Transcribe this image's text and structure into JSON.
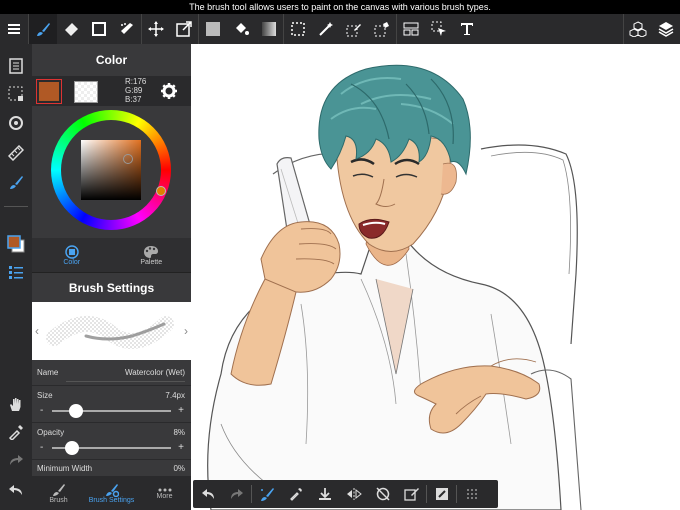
{
  "status_text": "The brush tool allows users to paint on the canvas with various brush types.",
  "color_panel": {
    "title": "Color",
    "rgb": {
      "r": "R:176",
      "g": "G:89",
      "b": "B:37"
    },
    "primary_color": "#b05925",
    "tabs": [
      {
        "label": "Color",
        "icon": "color-circle-icon",
        "active": true
      },
      {
        "label": "Palette",
        "icon": "palette-icon",
        "active": false
      }
    ]
  },
  "brush_settings": {
    "title": "Brush Settings",
    "name_label": "Name",
    "name_value": "Watercolor (Wet)",
    "size_label": "Size",
    "size_value": "7.4px",
    "size_fraction": 0.2,
    "opacity_label": "Opacity",
    "opacity_value": "8%",
    "opacity_fraction": 0.17,
    "min_width_label": "Minimum Width",
    "min_width_value": "0%"
  },
  "bottom_tabs": [
    {
      "label": "Brush",
      "icon": "brush-icon",
      "active": false
    },
    {
      "label": "Brush Settings",
      "icon": "brush-settings-icon",
      "active": true
    },
    {
      "label": "More",
      "icon": "more-icon",
      "active": false
    }
  ],
  "accent_color": "#4aa3f0"
}
